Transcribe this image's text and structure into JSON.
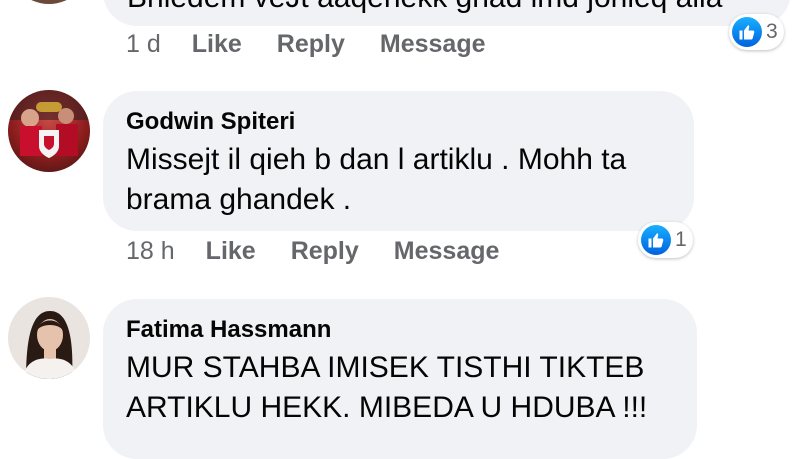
{
  "comments": [
    {
      "author": "",
      "text_line1": "Bhiedem veJt aaqenekk ghad imd jonieq aila",
      "time": "1 d",
      "like_label": "Like",
      "reply_label": "Reply",
      "message_label": "Message",
      "reaction_count": "3",
      "reaction_icon": "thumbs-up-icon"
    },
    {
      "author": "Godwin Spiteri",
      "text_line1": "Missejt il qieh b dan l artiklu . Mohh ta",
      "text_line2": "brama ghandek .",
      "time": "18 h",
      "like_label": "Like",
      "reply_label": "Reply",
      "message_label": "Message",
      "reaction_count": "1",
      "reaction_icon": "thumbs-up-icon"
    },
    {
      "author": "Fatima Hassmann",
      "text_line1": "MUR STAHBA IMISEK TISTHI TIKTEB",
      "text_line2": "ARTIKLU HEKK. MIBEDA U HDUBA !!!"
    }
  ],
  "colors": {
    "bubble_bg": "#f0f2f5",
    "action_text": "#65676b",
    "like_blue": "#1877f2"
  }
}
